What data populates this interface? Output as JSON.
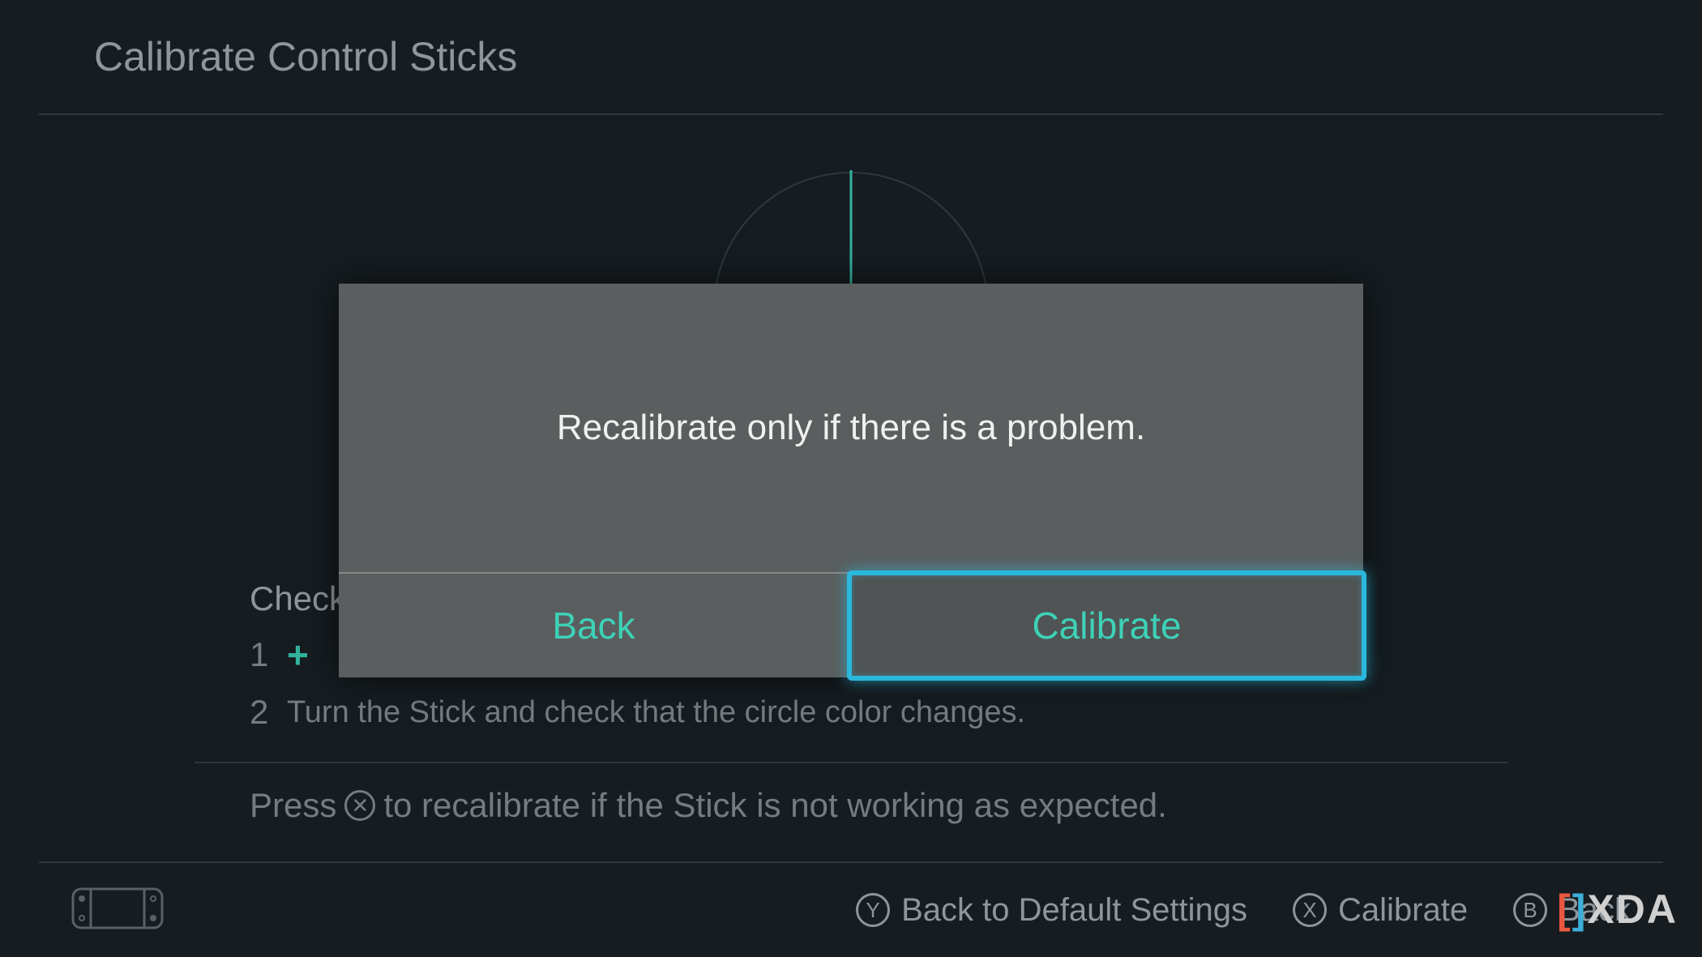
{
  "header": {
    "title": "Calibrate Control Sticks"
  },
  "instructions": {
    "check_label": "Check",
    "step1_num": "1",
    "step2_num": "2",
    "step2_text": "Turn the Stick and check that the circle color changes."
  },
  "recalibrate_hint": {
    "prefix": "Press",
    "icon": "✕",
    "suffix": "to recalibrate if the Stick is not working as expected."
  },
  "footer": {
    "y_label": "Back to Default Settings",
    "x_label": "Calibrate",
    "b_label": "Back",
    "y_btn": "Y",
    "x_btn": "X",
    "b_btn": "B"
  },
  "dialog": {
    "message": "Recalibrate only if there is a problem.",
    "back": "Back",
    "calibrate": "Calibrate"
  },
  "watermark": {
    "text": "XDA"
  }
}
